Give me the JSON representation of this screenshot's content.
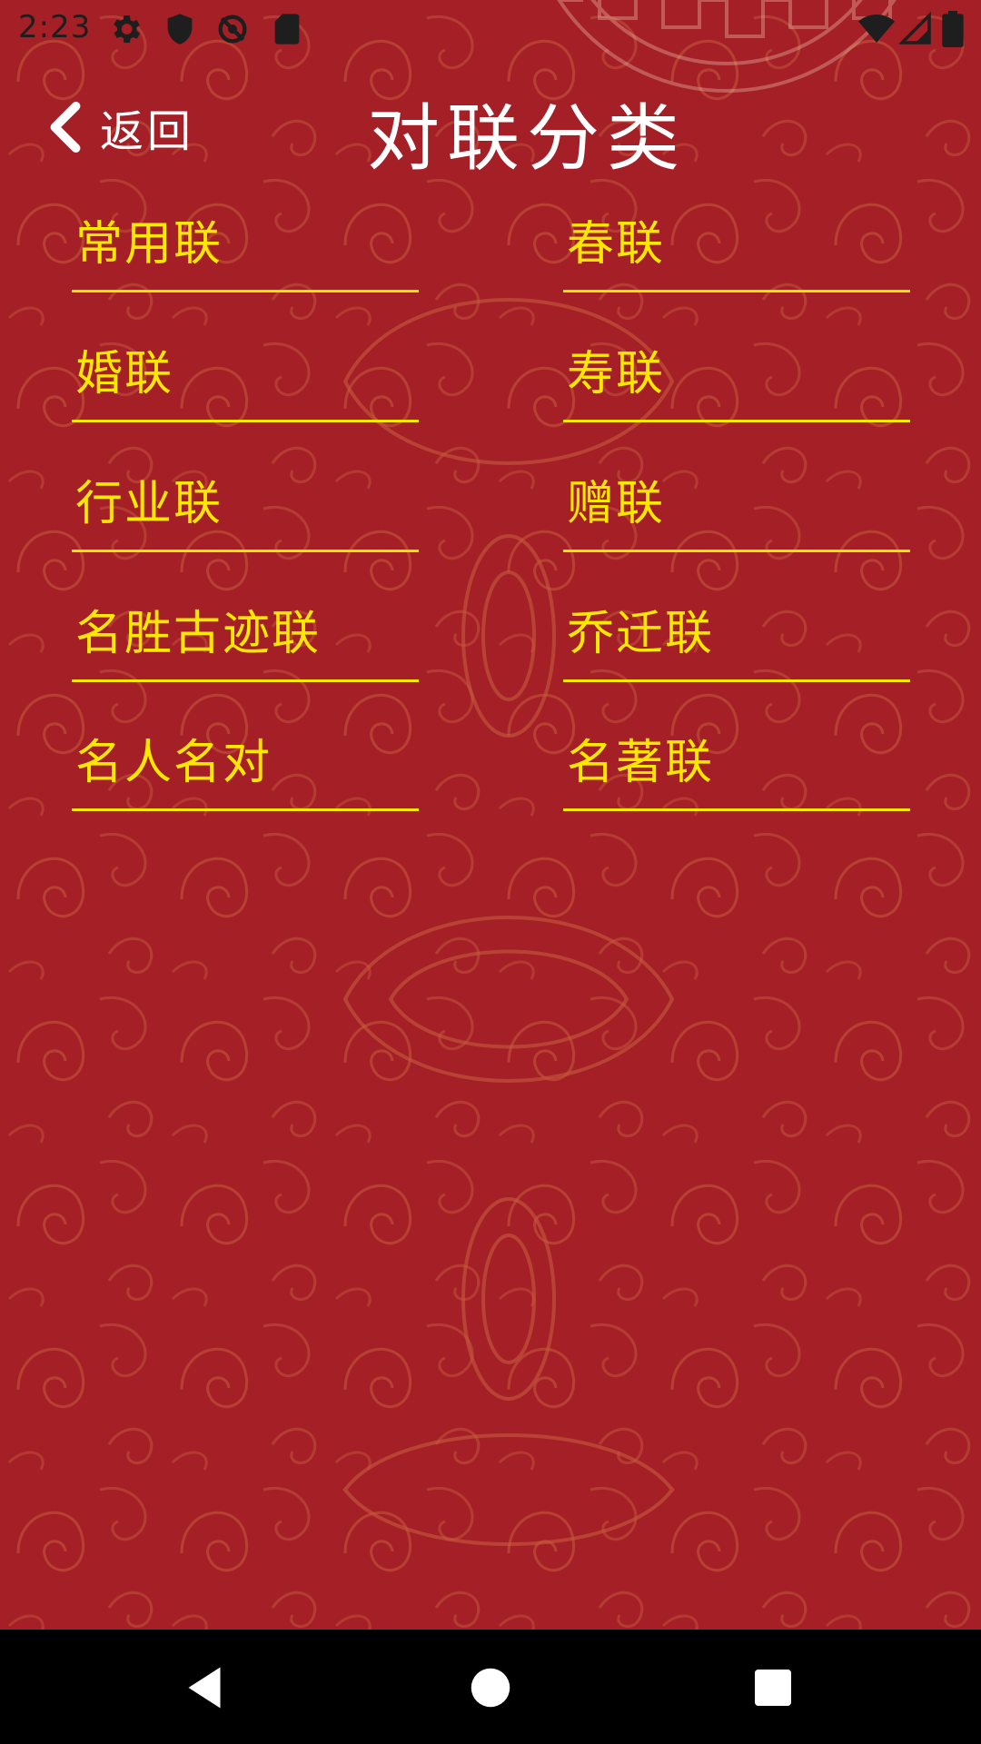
{
  "status_bar": {
    "time": "2:23",
    "left_icons": [
      "gear-icon",
      "shield-icon",
      "sync-disabled-icon",
      "sd-card-icon"
    ],
    "right_icons": [
      "wifi-icon",
      "signal-icon",
      "battery-icon"
    ]
  },
  "header": {
    "back_label": "返回",
    "title": "对联分类"
  },
  "categories": [
    {
      "label": "常用联"
    },
    {
      "label": "春联"
    },
    {
      "label": "婚联"
    },
    {
      "label": "寿联"
    },
    {
      "label": "行业联"
    },
    {
      "label": "赠联"
    },
    {
      "label": "名胜古迹联"
    },
    {
      "label": "乔迁联"
    },
    {
      "label": "名人名对"
    },
    {
      "label": "名著联"
    }
  ],
  "colors": {
    "background": "#a51f26",
    "accent": "#ffe800",
    "title": "#ffffff"
  },
  "nav_bar": {
    "icons": [
      "back-icon",
      "home-icon",
      "recents-icon"
    ]
  }
}
